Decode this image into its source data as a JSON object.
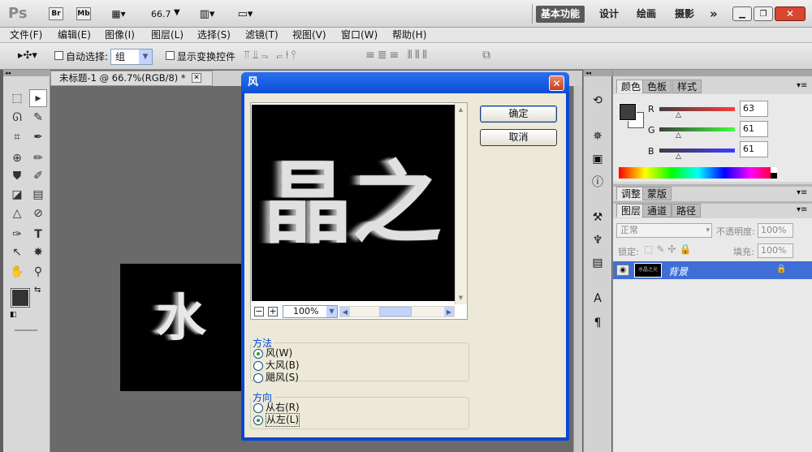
{
  "appbar": {
    "logo": "Ps",
    "bridge": "Br",
    "minibridge": "Mb",
    "zoom": "66.7",
    "workspaces": [
      "基本功能",
      "设计",
      "绘画",
      "摄影"
    ],
    "more": "»"
  },
  "menus": [
    "文件(F)",
    "编辑(E)",
    "图像(I)",
    "图层(L)",
    "选择(S)",
    "滤镜(T)",
    "视图(V)",
    "窗口(W)",
    "帮助(H)"
  ],
  "options": {
    "auto_select_label": "自动选择:",
    "auto_select_value": "组",
    "transform_label": "显示变换控件"
  },
  "document": {
    "tab_title": "未标题-1 @ 66.7%(RGB/8) *",
    "canvas_text": "水"
  },
  "dialog": {
    "title": "风",
    "preview_text": "晶之",
    "ok": "确定",
    "cancel": "取消",
    "zoom": "100%",
    "method": {
      "legend": "方法",
      "options": [
        "风(W)",
        "大风(B)",
        "飓风(S)"
      ],
      "selected": 0
    },
    "direction": {
      "legend": "方向",
      "options": [
        "从右(R)",
        "从左(L)"
      ],
      "selected": 1
    }
  },
  "color_panel": {
    "tabs": [
      "颜色",
      "色板",
      "样式"
    ],
    "r_label": "R",
    "g_label": "G",
    "b_label": "B",
    "r": "63",
    "g": "61",
    "b": "61"
  },
  "adjust_panel": {
    "tabs": [
      "调整",
      "蒙版"
    ]
  },
  "layers_panel": {
    "tabs": [
      "图层",
      "通道",
      "路径"
    ],
    "blend_mode": "正常",
    "opacity_label": "不透明度:",
    "opacity": "100%",
    "lock_label": "锁定:",
    "fill_label": "填充:",
    "fill": "100%",
    "layer_name": "背景",
    "thumb_text": "水晶之光"
  },
  "colors": {
    "dialog_blue": "#0a46d4",
    "layer_selected": "#3f6fd6"
  }
}
